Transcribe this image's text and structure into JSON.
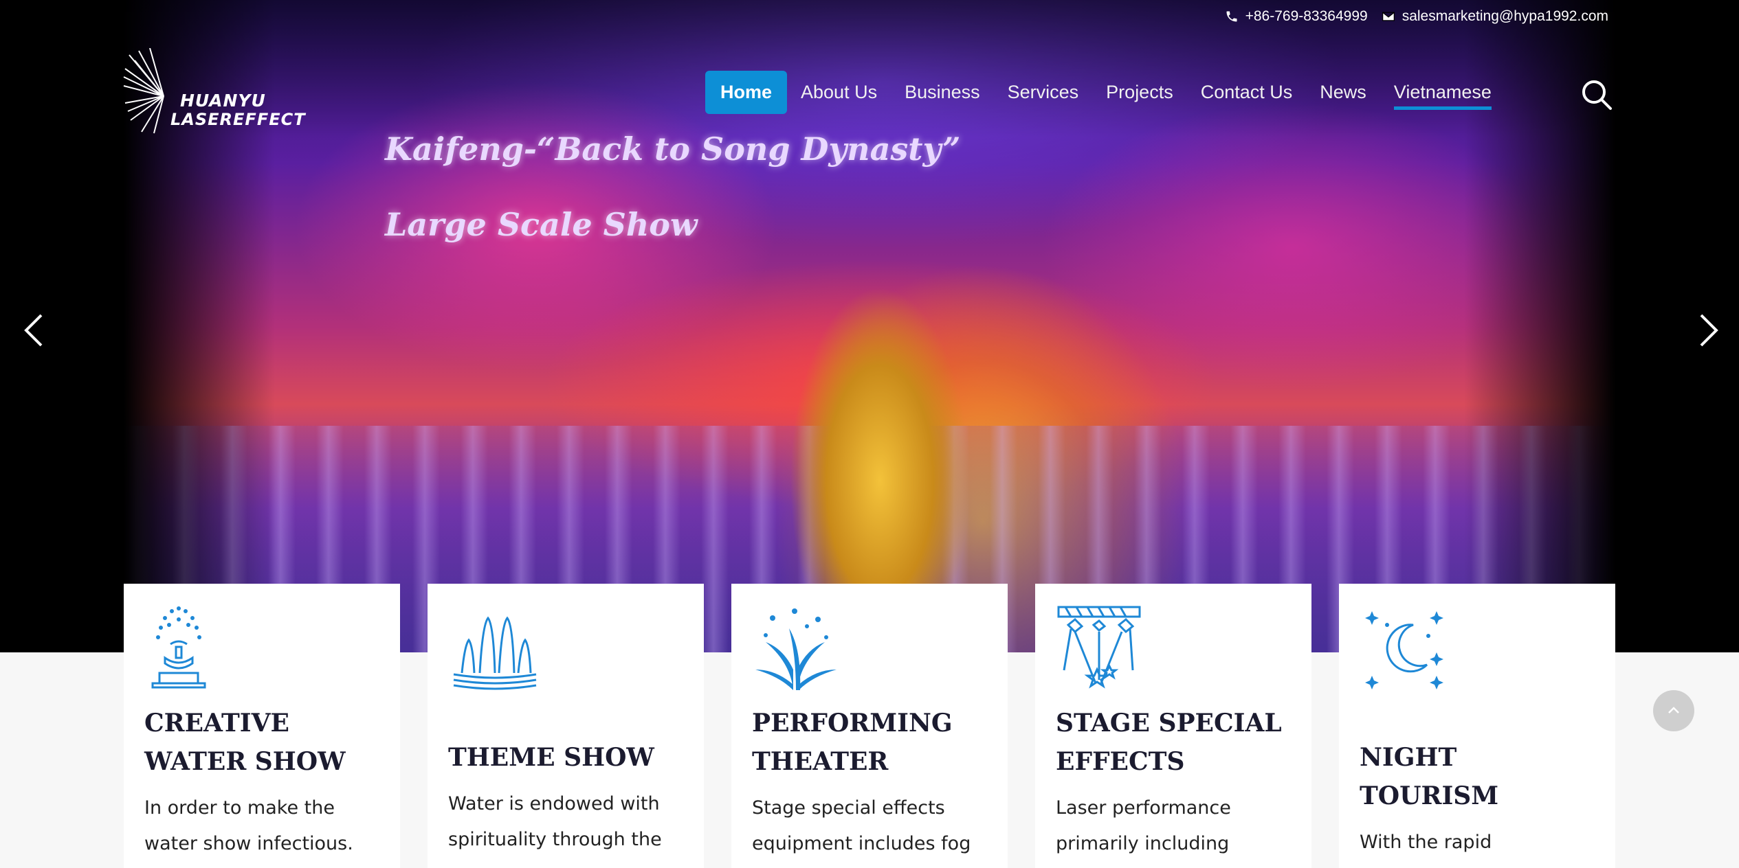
{
  "topbar": {
    "phone": "+86-769-83364999",
    "email": "salesmarketing@hypa1992.com"
  },
  "logo": {
    "line1": "HUANYU",
    "line2": "LASEREFFECT"
  },
  "nav": {
    "items": [
      {
        "label": "Home"
      },
      {
        "label": "About Us"
      },
      {
        "label": "Business"
      },
      {
        "label": "Services"
      },
      {
        "label": "Projects"
      },
      {
        "label": "Contact Us"
      },
      {
        "label": "News"
      },
      {
        "label": "Vietnamese"
      }
    ]
  },
  "hero": {
    "caption_line1": "Kaifeng-“Back to Song Dynasty”",
    "caption_line2": "Large Scale Show"
  },
  "cards": [
    {
      "icon": "fountain-icon",
      "title": "CREATIVE WATER SHOW",
      "text": "In order to make the water show infectious. We"
    },
    {
      "icon": "water-jets-icon",
      "title": "THEME SHOW",
      "text": "Water is endowed with spirituality through the"
    },
    {
      "icon": "firework-icon",
      "title": "PERFORMING THEATER",
      "text": "Stage special effects equipment includes fog"
    },
    {
      "icon": "stage-lights-icon",
      "title": "STAGE SPECIAL EFFECTS",
      "text": "Laser performance primarily including indoor"
    },
    {
      "icon": "moon-stars-icon",
      "title": "NIGHT TOURISM",
      "text": "With the rapid development of night"
    }
  ],
  "colors": {
    "accent": "#0d8fd6",
    "heading": "#1b1b2f",
    "icon": "#1e88d6"
  }
}
